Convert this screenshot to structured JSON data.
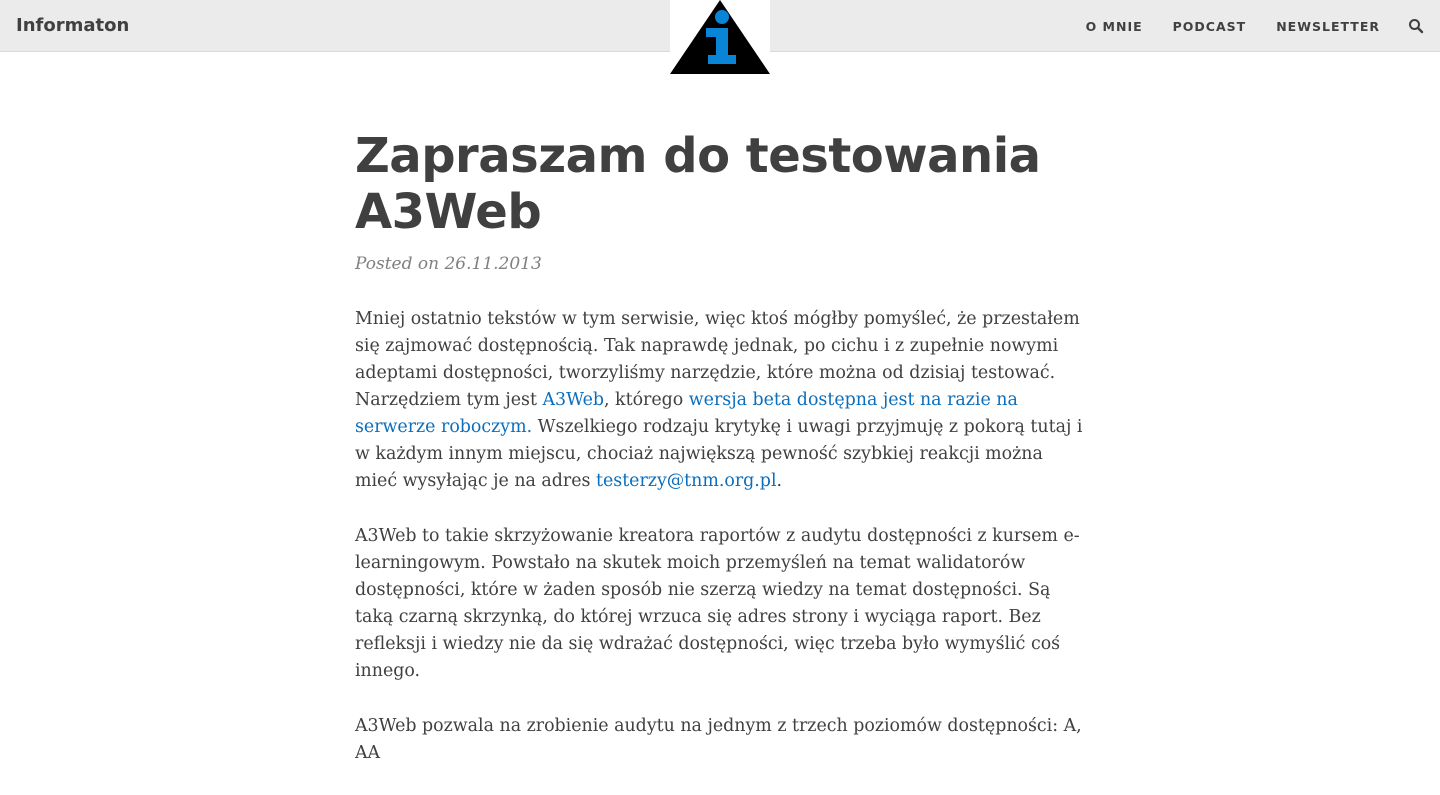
{
  "site": {
    "brand": "Informaton",
    "logo_name": "info-triangle-logo",
    "colors": {
      "navbar_bg": "#ebebeb",
      "link": "#0a6ebd",
      "text": "#404040",
      "logo_accent": "#0a84d6"
    }
  },
  "nav": {
    "items": [
      {
        "label": "O MNIE"
      },
      {
        "label": "PODCAST"
      },
      {
        "label": "NEWSLETTER"
      }
    ],
    "search_icon": "search-icon"
  },
  "post": {
    "title": "Zapraszam do testowania A3Web",
    "meta": "Posted on 26.11.2013",
    "p1": {
      "t1": "Mniej ostatnio tekstów w tym serwisie, więc ktoś mógłby pomyśleć, że przestałem się zajmować dostępnością. Tak naprawdę jednak, po cichu i z zupełnie nowymi adeptami dostępności, tworzyliśmy narzędzie, które można od dzisiaj testować. Narzędziem tym jest ",
      "link1": "A3Web",
      "t2": ", którego ",
      "link2": "wersja beta dostępna jest na razie na serwerze roboczym.",
      "t3": " Wszelkiego rodzaju krytykę i uwagi przyjmuję z pokorą tutaj i w każdym innym miejscu, chociaż największą pewność szybkiej reakcji można mieć wysyłając je na adres ",
      "link3": "testerzy@tnm.org.pl",
      "t4": "."
    },
    "p2": "A3Web to takie skrzyżowanie kreatora raportów z audytu dostępności z kursem e-learningowym. Powstało na skutek moich przemyśleń na temat walidatorów dostępności, które w żaden sposób nie szerzą wiedzy na temat dostępności. Są taką czarną skrzynką, do której wrzuca się adres strony i wyciąga raport. Bez refleksji i wiedzy nie da się wdrażać dostępności, więc trzeba było wymyślić coś innego.",
    "p3": "A3Web pozwala na zrobienie audytu na jednym z trzech poziomów dostępności: A, AA"
  }
}
